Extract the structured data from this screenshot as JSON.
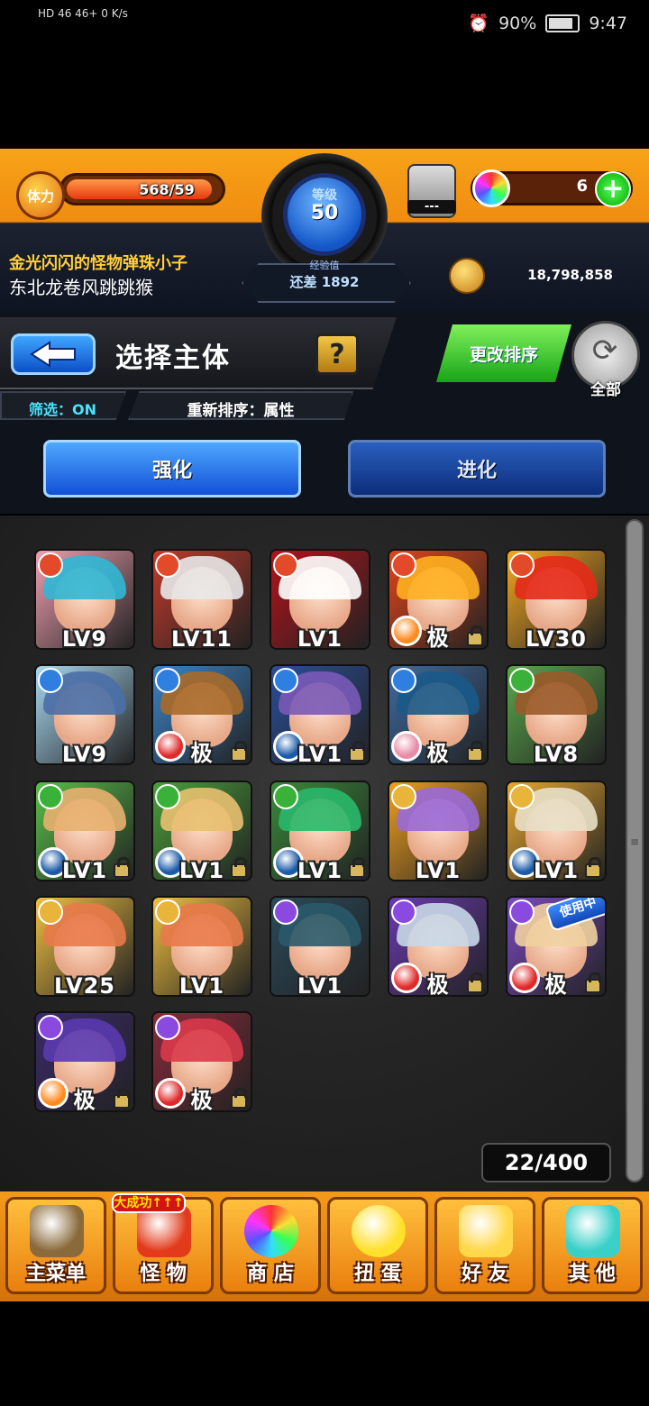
{
  "status_bar": {
    "left_text": "HD 46 46+ 0 K/s",
    "battery": "90%",
    "time": "9:47"
  },
  "header": {
    "stamina_label": "体力",
    "stamina_value": "568",
    "stamina_max": "/59",
    "stamina_fill": 0.96,
    "level_label": "等级",
    "level_value": "50",
    "exp_label": "经验值",
    "exp_remaining": "还差 1892",
    "gacha_text": "---",
    "orb_count": "6",
    "plus_symbol": "+",
    "player_title": "金光闪闪的怪物弹珠小子",
    "player_name": "东北龙卷风跳跳猴",
    "coins": "18,798,858"
  },
  "panel": {
    "title": "选择主体",
    "help_symbol": "?",
    "filter": "筛选：ON",
    "sort": "重新排序：属性",
    "sort_button": "更改排序",
    "all_button": "全部",
    "tabs": [
      "强化",
      "进化"
    ]
  },
  "grid": {
    "cards": [
      {
        "lv": "LV9",
        "attr": "#e24a2a",
        "hair": "#2fb8d6",
        "bg": "#f0a0b0",
        "orb": "",
        "lock": false,
        "in_use": false
      },
      {
        "lv": "LV11",
        "attr": "#e24a2a",
        "hair": "#e8e8e8",
        "bg": "#c23a2a",
        "orb": "",
        "lock": false,
        "in_use": false
      },
      {
        "lv": "LV1",
        "attr": "#e24a2a",
        "hair": "#ffffff",
        "bg": "#b4121a",
        "orb": "",
        "lock": false,
        "in_use": false
      },
      {
        "lv": "极",
        "attr": "#e24a2a",
        "hair": "#ffb020",
        "bg": "#e2451a",
        "orb": "#ff8a1e",
        "lock": true,
        "in_use": false
      },
      {
        "lv": "LV30",
        "attr": "#e24a2a",
        "hair": "#e62a1a",
        "bg": "#f5a820",
        "orb": "",
        "lock": false,
        "in_use": false
      },
      {
        "lv": "LV9",
        "attr": "#2f7fe0",
        "hair": "#4a6fa8",
        "bg": "#a8d8f0",
        "orb": "",
        "lock": false,
        "in_use": false
      },
      {
        "lv": "极",
        "attr": "#2f7fe0",
        "hair": "#a86a2a",
        "bg": "#3a84c8",
        "orb": "#e02a2a",
        "lock": true,
        "in_use": false
      },
      {
        "lv": "LV1",
        "attr": "#2f7fe0",
        "hair": "#7a5ab8",
        "bg": "#2a4e9a",
        "orb": "#1a5aa8",
        "lock": true,
        "in_use": false
      },
      {
        "lv": "极",
        "attr": "#2f7fe0",
        "hair": "#1a5a8a",
        "bg": "#3e6aa0",
        "orb": "#e88aa8",
        "lock": true,
        "in_use": false
      },
      {
        "lv": "LV8",
        "attr": "#3ab23a",
        "hair": "#9a5a2a",
        "bg": "#5aa84a",
        "orb": "",
        "lock": false,
        "in_use": false
      },
      {
        "lv": "LV1",
        "attr": "#3ab23a",
        "hair": "#e8b070",
        "bg": "#5ac04a",
        "orb": "#1a5aa8",
        "lock": true,
        "in_use": false
      },
      {
        "lv": "LV1",
        "attr": "#3ab23a",
        "hair": "#e8c070",
        "bg": "#4aa03a",
        "orb": "#1a5aa8",
        "lock": true,
        "in_use": false
      },
      {
        "lv": "LV1",
        "attr": "#3ab23a",
        "hair": "#2ab86a",
        "bg": "#3a8a3a",
        "orb": "#1a5aa8",
        "lock": true,
        "in_use": false
      },
      {
        "lv": "LV1",
        "attr": "#e8b43a",
        "hair": "#9a6ad8",
        "bg": "#f0a020",
        "orb": "",
        "lock": false,
        "in_use": false
      },
      {
        "lv": "LV1",
        "attr": "#e8b43a",
        "hair": "#e8e0c8",
        "bg": "#e8a830",
        "orb": "#1a5aa8",
        "lock": true,
        "in_use": false
      },
      {
        "lv": "LV25",
        "attr": "#e8b43a",
        "hair": "#e87a4a",
        "bg": "#f0c040",
        "orb": "",
        "lock": false,
        "in_use": false
      },
      {
        "lv": "LV1",
        "attr": "#e8b43a",
        "hair": "#e87a4a",
        "bg": "#f0c040",
        "orb": "",
        "lock": false,
        "in_use": false
      },
      {
        "lv": "LV1",
        "attr": "#8a4ae0",
        "hair": "#2a5a6a",
        "bg": "#2a4a5a",
        "orb": "",
        "lock": false,
        "in_use": false
      },
      {
        "lv": "极",
        "attr": "#8a4ae0",
        "hair": "#c8d8e8",
        "bg": "#6a3ab0",
        "orb": "#e02a2a",
        "lock": true,
        "in_use": false
      },
      {
        "lv": "极",
        "attr": "#8a4ae0",
        "hair": "#f0d0a0",
        "bg": "#7a4ac0",
        "orb": "#e02a2a",
        "lock": true,
        "in_use": true
      },
      {
        "lv": "极",
        "attr": "#8a4ae0",
        "hair": "#5a3ab0",
        "bg": "#3a2a6a",
        "orb": "#ff8a1e",
        "lock": true,
        "in_use": false
      },
      {
        "lv": "极",
        "attr": "#8a4ae0",
        "hair": "#d83a4a",
        "bg": "#8a2a3a",
        "orb": "#e02a2a",
        "lock": true,
        "in_use": false
      }
    ],
    "in_use_label": "使用中",
    "box_count": "22/400"
  },
  "bottom_nav": {
    "badge": "大成功↑↑↑",
    "items": [
      {
        "label": "主菜单",
        "color": "#8a6a3a"
      },
      {
        "label": "怪 物",
        "color": "#e23a1a"
      },
      {
        "label": "商 店",
        "color": "#ffffff"
      },
      {
        "label": "扭 蛋",
        "color": "#ffe02a"
      },
      {
        "label": "好 友",
        "color": "#ffd84a"
      },
      {
        "label": "其 他",
        "color": "#3ad0c8"
      }
    ]
  }
}
